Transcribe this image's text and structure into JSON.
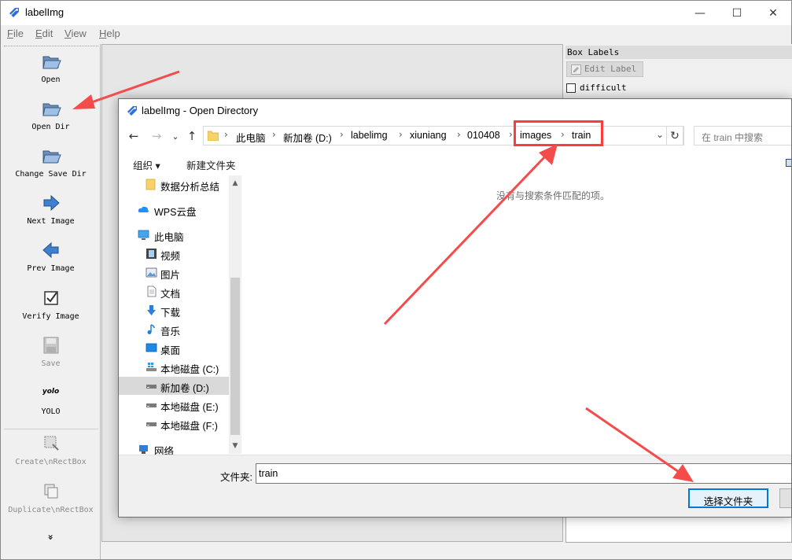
{
  "window": {
    "title": "labelImg",
    "controls": {
      "minimize": "—",
      "maximize": "☐",
      "close": "✕"
    }
  },
  "menu": {
    "items": [
      {
        "u": "F",
        "rest": "ile"
      },
      {
        "u": "E",
        "rest": "dit"
      },
      {
        "u": "V",
        "rest": "iew"
      },
      {
        "u": "H",
        "rest": "elp"
      }
    ]
  },
  "toolbar": {
    "open": "Open",
    "open_dir": "Open Dir",
    "change_save_dir": "Change Save Dir",
    "next_image": "Next Image",
    "prev_image": "Prev Image",
    "verify_image": "Verify Image",
    "save": "Save",
    "yolo_icon_text": "yolo",
    "yolo": "YOLO",
    "create_rect": "Create\\nRectBox",
    "duplicate_rect": "Duplicate\\nRectBox",
    "more": "»"
  },
  "right_panel": {
    "title": "Box Labels",
    "edit_label": "Edit Label",
    "difficult": "difficult"
  },
  "dialog": {
    "title": "labelImg - Open Directory",
    "nav": {
      "back": "←",
      "forward": "→",
      "recent": "⌄",
      "up": "↑"
    },
    "breadcrumbs": [
      "此电脑",
      "新加卷 (D:)",
      "labelimg",
      "xiuniang",
      "010408",
      "images",
      "train"
    ],
    "separator": "›",
    "address_dropdown": "⌄",
    "refresh": "↻",
    "search_placeholder": "在 train 中搜索",
    "organize": "组织 ▾",
    "new_folder": "新建文件夹",
    "nav_pane": [
      {
        "label": "数据分析总结",
        "icon": "folder-icon"
      },
      {
        "label": "WPS云盘",
        "icon": "cloud-icon"
      },
      {
        "label": "此电脑",
        "icon": "computer-icon"
      },
      {
        "label": "视频",
        "icon": "video-icon"
      },
      {
        "label": "图片",
        "icon": "picture-icon"
      },
      {
        "label": "文档",
        "icon": "document-icon"
      },
      {
        "label": "下载",
        "icon": "download-icon"
      },
      {
        "label": "音乐",
        "icon": "music-icon"
      },
      {
        "label": "桌面",
        "icon": "desktop-icon"
      },
      {
        "label": "本地磁盘 (C:)",
        "icon": "system-drive-icon"
      },
      {
        "label": "新加卷 (D:)",
        "icon": "drive-icon"
      },
      {
        "label": "本地磁盘 (E:)",
        "icon": "drive-icon"
      },
      {
        "label": "本地磁盘 (F:)",
        "icon": "drive-icon"
      },
      {
        "label": "网络",
        "icon": "network-icon"
      }
    ],
    "selected_nav": "新加卷 (D:)",
    "empty_message": "没有与搜索条件匹配的项。",
    "folder_label": "文件夹:",
    "folder_value": "train",
    "select_folder_button": "选择文件夹"
  },
  "colors": {
    "accent": "#0078d7",
    "highlight_red": "#ff3b3b",
    "arrow_red": "#f44b4b"
  }
}
